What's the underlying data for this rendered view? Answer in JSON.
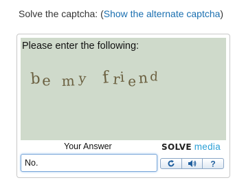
{
  "header": {
    "prefix": "Solve the captcha: (",
    "link_text": "Show the alternate captcha",
    "suffix": ")"
  },
  "captcha": {
    "instruction": "Please enter the following:",
    "challenge_text": "be my friend",
    "background_color": "#cfdacb",
    "text_color": "#6b6040"
  },
  "answer": {
    "label": "Your Answer",
    "value": "No."
  },
  "brand": {
    "solve": "SOLVE",
    "media": "media",
    "accent": "#2a9fd6"
  },
  "controls": [
    {
      "icon": "refresh-icon"
    },
    {
      "icon": "audio-icon"
    },
    {
      "icon": "help-icon"
    }
  ]
}
